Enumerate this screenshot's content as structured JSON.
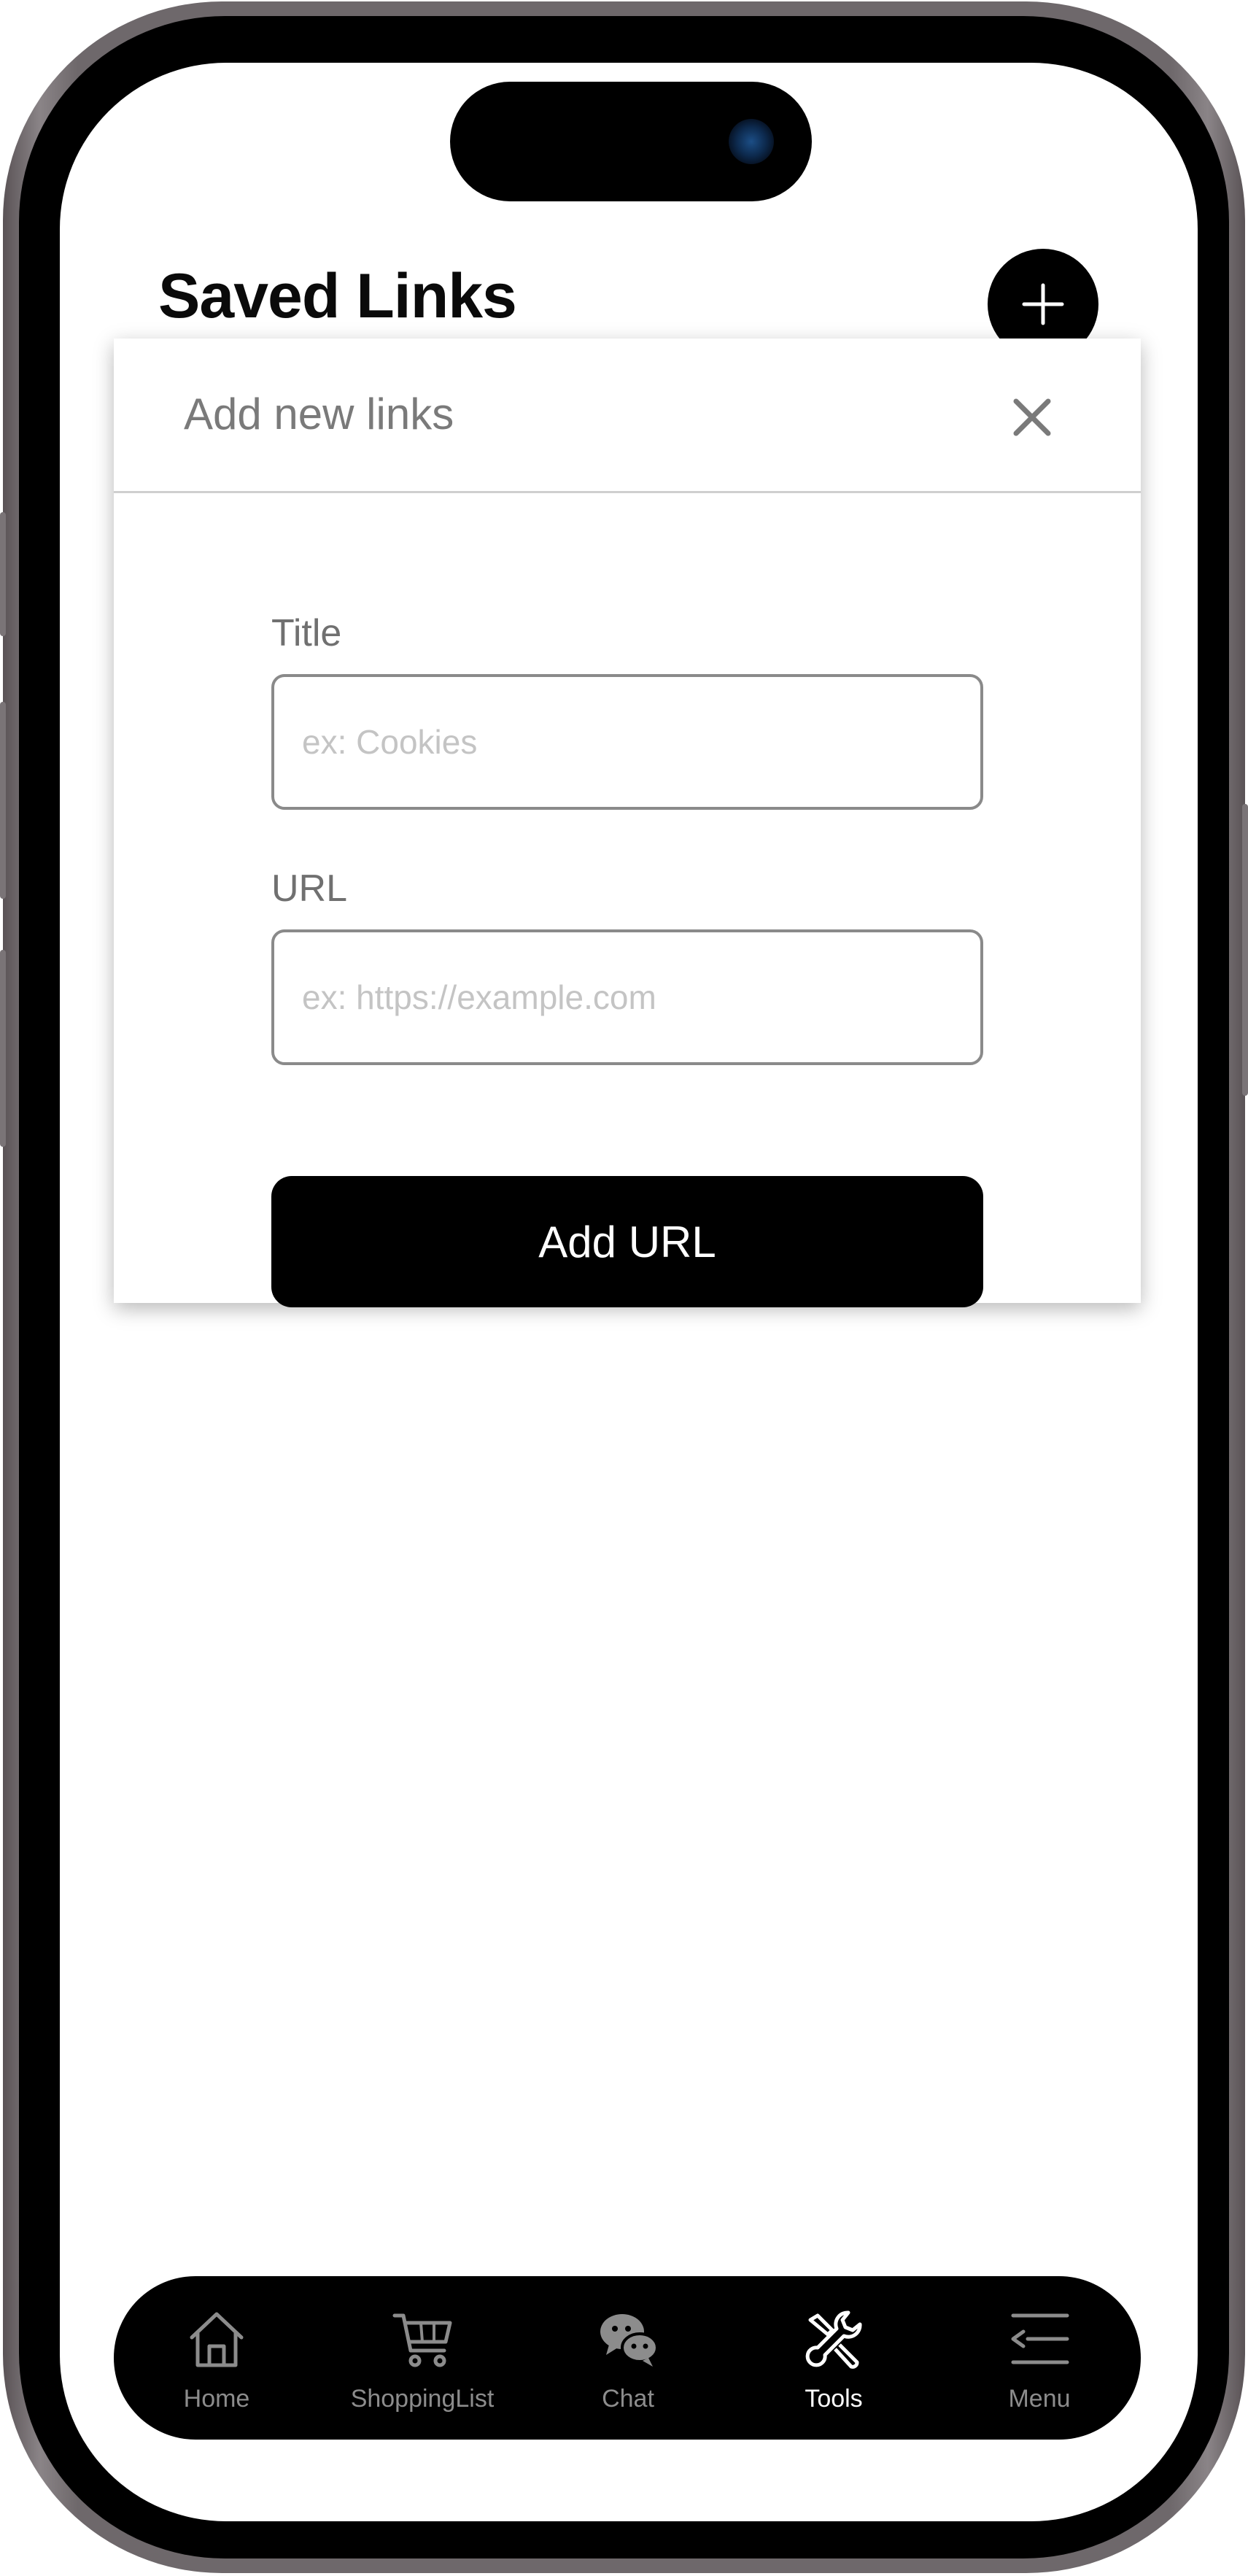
{
  "header": {
    "title": "Saved Links"
  },
  "modal": {
    "title": "Add new links",
    "fields": [
      {
        "label": "Title",
        "value": "",
        "placeholder": "ex: Cookies"
      },
      {
        "label": "URL",
        "value": "",
        "placeholder": "ex: https://example.com"
      }
    ],
    "submit_label": "Add URL"
  },
  "tab_bar": {
    "active": "Tools",
    "items": [
      {
        "label": "Home",
        "icon": "home-icon"
      },
      {
        "label": "ShoppingList",
        "icon": "cart-icon"
      },
      {
        "label": "Chat",
        "icon": "chat-icon"
      },
      {
        "label": "Tools",
        "icon": "tools-icon"
      },
      {
        "label": "Menu",
        "icon": "menu-icon"
      }
    ]
  },
  "colors": {
    "accent": "#000000",
    "tab_active": "#ffffff",
    "tab_inactive": "#8c8c8c",
    "muted_text": "#7a7a7a",
    "placeholder": "#c4c4c4"
  }
}
